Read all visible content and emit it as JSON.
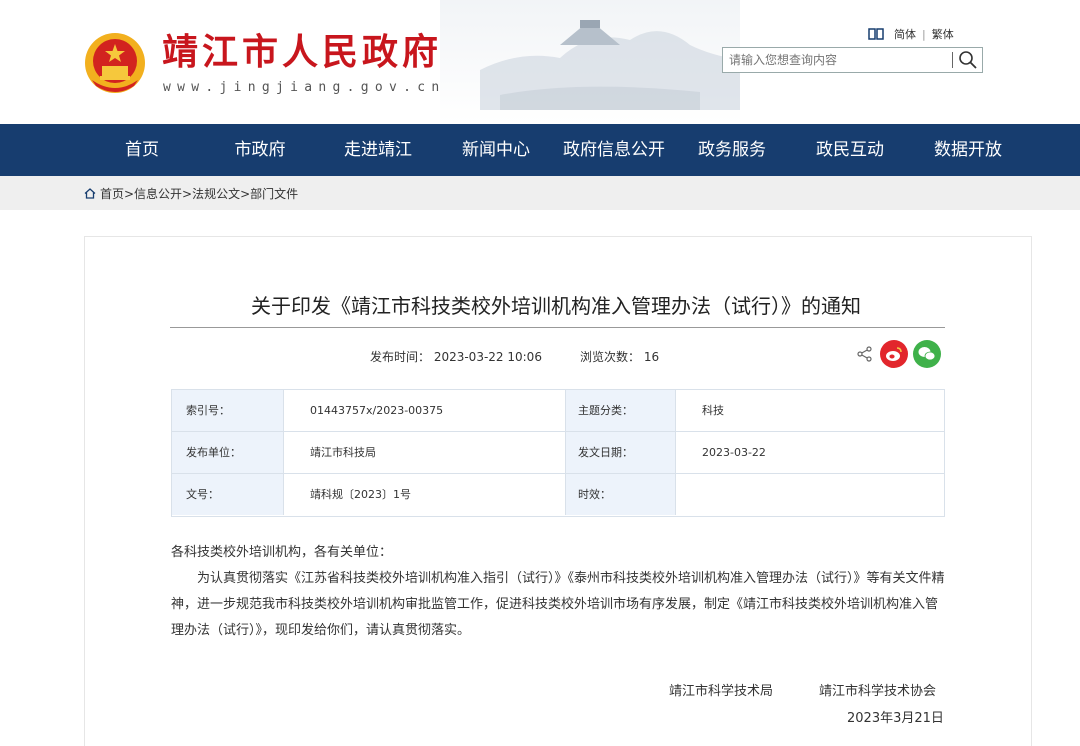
{
  "header": {
    "site_title": "靖江市人民政府",
    "site_url": "www.jingjiang.gov.cn",
    "lang_simplified": "简体",
    "lang_sep": "|",
    "lang_traditional": "繁体",
    "search_placeholder": "请输入您想查询内容"
  },
  "nav": {
    "items": [
      {
        "label": "首页"
      },
      {
        "label": "市政府"
      },
      {
        "label": "走进靖江"
      },
      {
        "label": "新闻中心"
      },
      {
        "label": "政府信息公开"
      },
      {
        "label": "政务服务"
      },
      {
        "label": "政民互动"
      },
      {
        "label": "数据开放"
      }
    ],
    "bg_color": "#173d6f"
  },
  "breadcrumb": {
    "text": "首页>信息公开>法规公文>部门文件"
  },
  "article": {
    "title": "关于印发《靖江市科技类校外培训机构准入管理办法（试行）》的通知",
    "publish_time": "发布时间： 2023-03-22 10:06",
    "views": "浏览次数： 16"
  },
  "info_table": {
    "rows": [
      {
        "l1": "索引号：",
        "v1": "01443757x/2023-00375",
        "l2": "主题分类：",
        "v2": "科技"
      },
      {
        "l1": "发布单位：",
        "v1": "靖江市科技局",
        "l2": "发文日期：",
        "v2": "2023-03-22"
      },
      {
        "l1": "文号：",
        "v1": "靖科规〔2023〕1号",
        "l2": "时效：",
        "v2": ""
      }
    ]
  },
  "body": {
    "salutation": "各科技类校外培训机构，各有关单位：",
    "paragraph": "为认真贯彻落实《江苏省科技类校外培训机构准入指引（试行）》《泰州市科技类校外培训机构准入管理办法（试行）》等有关文件精神，进一步规范我市科技类校外培训机构审批监管工作，促进科技类校外培训市场有序发展，制定《靖江市科技类校外培训机构准入管理办法（试行）》，现印发给你们，请认真贯彻落实。",
    "signer1": "靖江市科学技术局",
    "signer2": "靖江市科学技术协会",
    "date": "2023年3月21日"
  },
  "colors": {
    "title_red": "#c8161d",
    "weibo_red": "#e2262c",
    "wechat_green": "#3fb14a"
  }
}
